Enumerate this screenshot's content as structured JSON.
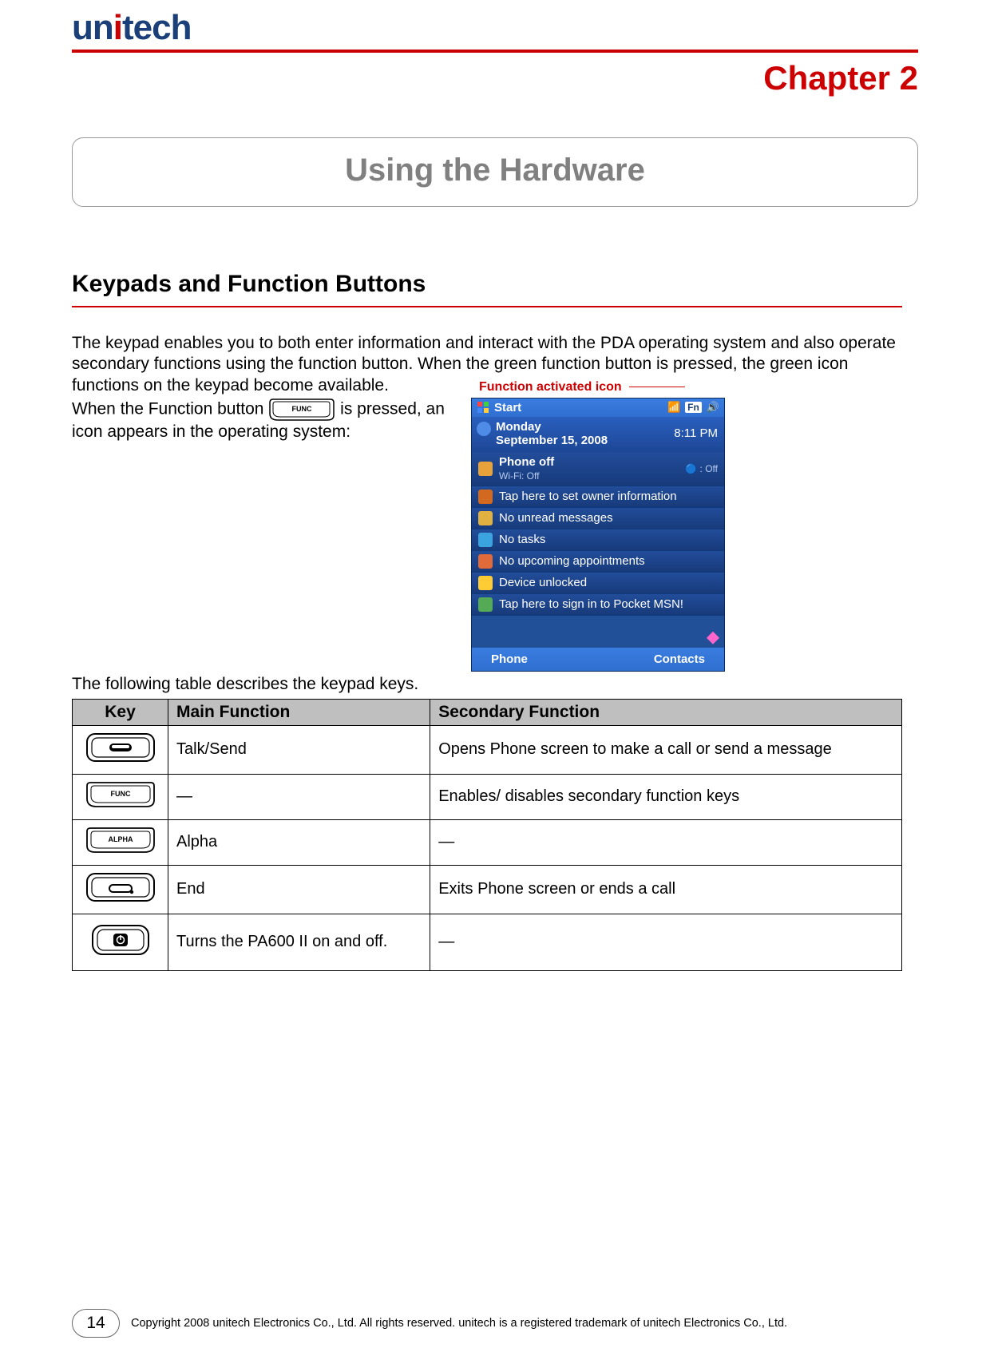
{
  "brand": {
    "part1": "un",
    "part2": "i",
    "part3": "tech"
  },
  "chapter_label": "Chapter  2",
  "title_box": "Using the Hardware",
  "section_heading": "Keypads and Function Buttons",
  "intro_paragraph": "The keypad enables you to both enter information and interact with the PDA operating system and also operate secondary functions using the function button. When the green function button is pressed, the green icon functions on the keypad become available.",
  "func_sentence_pre": "When the Function button ",
  "func_sentence_post": " is pressed, an icon appears in the operating system:",
  "callout_label": "Function activated icon",
  "pda": {
    "title": "Start",
    "fn_chip": "Fn",
    "date_day": "Monday",
    "date_full": "September 15, 2008",
    "time": "8:11 PM",
    "phone_off": "Phone off",
    "wifi": "Wi-Fi: Off",
    "bt": "Off",
    "owner": "Tap here to set owner information",
    "messages": "No unread messages",
    "tasks": "No tasks",
    "appts": "No upcoming appointments",
    "locked": "Device unlocked",
    "msn": "Tap here to sign in to Pocket MSN!",
    "soft_left": "Phone",
    "soft_right": "Contacts"
  },
  "table_note": "The following table describes the keypad keys.",
  "table": {
    "headers": {
      "key": "Key",
      "main": "Main Function",
      "secondary": "Secondary Function"
    },
    "rows": [
      {
        "key_label": "talk",
        "main": "Talk/Send",
        "secondary": "Opens Phone screen to make a call or send a message"
      },
      {
        "key_label": "FUNC",
        "main": "—",
        "secondary": "Enables/ disables secondary function keys"
      },
      {
        "key_label": "ALPHA",
        "main": "Alpha",
        "secondary": "—"
      },
      {
        "key_label": "end",
        "main": "End",
        "secondary": "Exits Phone screen or ends a call"
      },
      {
        "key_label": "power",
        "main": "Turns the PA600 II on and off.",
        "secondary": "—"
      }
    ]
  },
  "page_number": "14",
  "copyright": "Copyright 2008 unitech Electronics Co., Ltd. All rights reserved. unitech is a registered trademark of unitech Electronics Co., Ltd."
}
